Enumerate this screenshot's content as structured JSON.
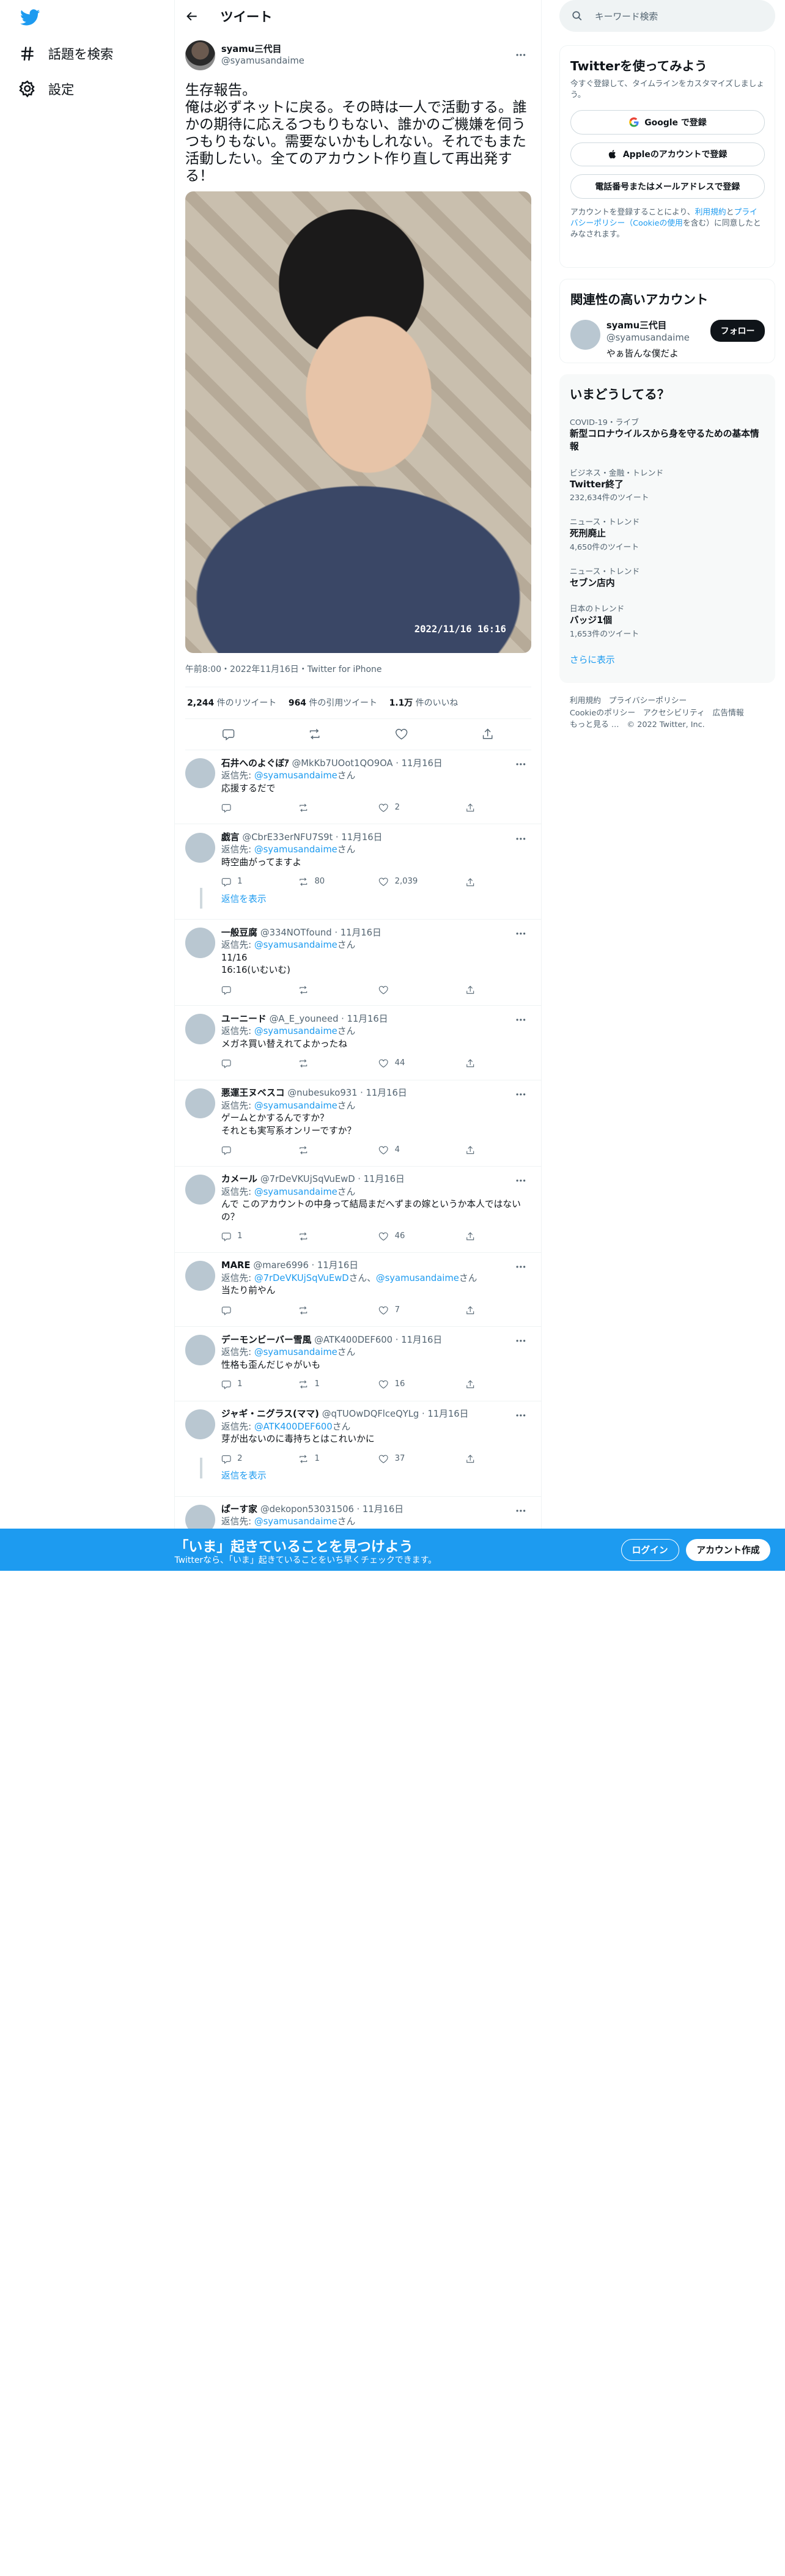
{
  "nav": {
    "explore": "話題を検索",
    "settings": "設定"
  },
  "header": {
    "title": "ツイート"
  },
  "tweet": {
    "display_name": "syamu三代目",
    "username": "@syamusandaime",
    "text": "生存報告。\n俺は必ずネットに戻る。その時は一人で活動する。誰かの期待に応えるつもりもない、誰かのご機嫌を伺うつもりもない。需要ないかもしれない。それでもまた活動したい。全てのアカウント作り直して再出発する！",
    "photo_timestamp": "2022/11/16 16:16",
    "meta": "午前8:00・2022年11月16日・Twitter for iPhone",
    "retweets": "2,244",
    "retweets_label": " 件のリツイート",
    "quotes": "964",
    "quotes_label": " 件の引用ツイート",
    "likes": "1.1万",
    "likes_label": " 件のいいね"
  },
  "replies": [
    {
      "name": "石井へのよぐぼｱ",
      "handle": "@MkKb7UOot1QO9OA · 11月16日",
      "to_label": "返信先: ",
      "to": "@syamusandaime",
      "to_suffix": "さん",
      "text": "応援するだで",
      "reply_count": "",
      "rt_count": "",
      "like_count": "2"
    },
    {
      "name": "戯言",
      "handle": "@CbrE33erNFU7S9t · 11月16日",
      "to_label": "返信先: ",
      "to": "@syamusandaime",
      "to_suffix": "さん",
      "text": "時空曲がってますよ",
      "reply_count": "1",
      "rt_count": "80",
      "like_count": "2,039",
      "show": "返信を表示"
    },
    {
      "name": "一般豆腐",
      "handle": "@334NOTfound · 11月16日",
      "to_label": "返信先: ",
      "to": "@syamusandaime",
      "to_suffix": "さん",
      "text": "11/16\n16:16(いむいむ)",
      "reply_count": "",
      "rt_count": "",
      "like_count": ""
    },
    {
      "name": "ユーニード",
      "handle": "@A_E_youneed · 11月16日",
      "to_label": "返信先: ",
      "to": "@syamusandaime",
      "to_suffix": "さん",
      "text": "メガネ買い替えれてよかったね",
      "reply_count": "",
      "rt_count": "",
      "like_count": "44"
    },
    {
      "name": "悪運王ヌベスコ",
      "handle": "@nubesuko931 · 11月16日",
      "to_label": "返信先: ",
      "to": "@syamusandaime",
      "to_suffix": "さん",
      "text": "ゲームとかするんですか？\nそれとも実写系オンリーですか？",
      "reply_count": "",
      "rt_count": "",
      "like_count": "4"
    },
    {
      "name": "カメール",
      "handle": "@7rDeVKUjSqVuEwD · 11月16日",
      "to_label": "返信先: ",
      "to": "@syamusandaime",
      "to_suffix": "さん",
      "text": "んで このアカウントの中身って結局まだへずまの嫁というか本人ではないの？",
      "reply_count": "1",
      "rt_count": "",
      "like_count": "46"
    },
    {
      "name": "MARE",
      "handle": "@mare6996 · 11月16日",
      "to_label": "返信先: ",
      "to": "@7rDeVKUjSqVuEwD",
      "to_mid": "さん、",
      "to2": "@syamusandaime",
      "to_suffix": "さん",
      "text": "当たり前やん",
      "reply_count": "",
      "rt_count": "",
      "like_count": "7"
    },
    {
      "name": "デーモンビーバー雪風",
      "handle": "@ATK400DEF600 · 11月16日",
      "to_label": "返信先: ",
      "to": "@syamusandaime",
      "to_suffix": "さん",
      "text": "性格も歪んだじゃがいも",
      "reply_count": "1",
      "rt_count": "1",
      "like_count": "16"
    },
    {
      "name": "ジャギ・ニグラス(ママ)",
      "handle": "@qTUOwDQFlceQYLg · 11月16日",
      "to_label": "返信先: ",
      "to": "@ATK400DEF600",
      "to_suffix": "さん",
      "text": "芽が出ないのに毒持ちとはこれいかに",
      "reply_count": "2",
      "rt_count": "1",
      "like_count": "37",
      "show": "返信を表示"
    },
    {
      "name": "ぱーす家",
      "handle": "@dekopon53031506 · 11月16日",
      "to_label": "返信先: ",
      "to": "@syamusandaime",
      "to_suffix": "さん",
      "text": ""
    }
  ],
  "sidebar": {
    "search_placeholder": "キーワード検索",
    "signup": {
      "title": "Twitterを使ってみよう",
      "desc": "今すぐ登録して、タイムラインをカスタマイズしましょう。",
      "google": "Google で登録",
      "apple": "Appleのアカウントで登録",
      "phone": "電話番号またはメールアドレスで登録",
      "terms_pre": "アカウントを登録することにより、",
      "terms_link1": "利用規約",
      "terms_and": "と",
      "terms_link2": "プライバシーポリシー",
      "terms_cookie": "（Cookieの使用",
      "terms_post": "を含む）に同意したとみなされます。"
    },
    "related": {
      "title": "関連性の高いアカウント",
      "name": "syamu三代目",
      "handle": "@syamusandaime",
      "bio": "やぁ皆んな僕だよ",
      "follow": "フォロー"
    },
    "trends": {
      "title": "いまどうしてる？",
      "items": [
        {
          "cat": "COVID-19・ライブ",
          "title": "新型コロナウイルスから身を守るための基本情報",
          "count": ""
        },
        {
          "cat": "ビジネス・金融・トレンド",
          "title": "Twitter終了",
          "count": "232,634件のツイート"
        },
        {
          "cat": "ニュース・トレンド",
          "title": "死刑廃止",
          "count": "4,650件のツイート"
        },
        {
          "cat": "ニュース・トレンド",
          "title": "セブン店内",
          "count": ""
        },
        {
          "cat": "日本のトレンド",
          "title": "バッジ1個",
          "count": "1,653件のツイート"
        }
      ],
      "more": "さらに表示"
    },
    "footer": {
      "l1": "利用規約　プライバシーポリシー",
      "l2": "Cookieのポリシー　アクセシビリティ　広告情報",
      "l3": "もっと見る …　© 2022 Twitter, Inc."
    }
  },
  "bottom": {
    "headline": "「いま」起きていることを見つけよう",
    "sub": "Twitterなら、「いま」起きていることをいち早くチェックできます。",
    "login": "ログイン",
    "signup": "アカウント作成"
  },
  "colors": {
    "accent": "#1d9bf0",
    "text": "#0f1419",
    "secondary": "#536471"
  }
}
